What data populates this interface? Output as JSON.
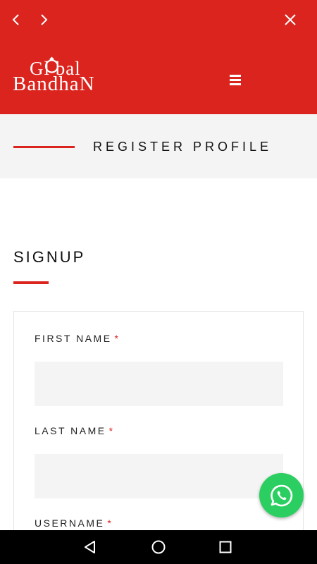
{
  "browser": {
    "back_icon": "chevron-left-icon",
    "forward_icon": "chevron-right-icon",
    "close_icon": "close-icon"
  },
  "header": {
    "logo_top": "Gl bal",
    "logo_bottom": "BandhaN",
    "menu_icon": "hamburger-menu-icon",
    "background_color": "#db241e"
  },
  "page_title": "REGISTER PROFILE",
  "signup": {
    "heading": "SIGNUP"
  },
  "form": {
    "fields": [
      {
        "label": "FIRST NAME",
        "required_mark": "*",
        "value": ""
      },
      {
        "label": "LAST NAME",
        "required_mark": "*",
        "value": ""
      },
      {
        "label": "USERNAME",
        "required_mark": "*"
      }
    ]
  },
  "whatsapp": {
    "icon": "whatsapp-icon",
    "color": "#2bcf61"
  },
  "system_nav": {
    "back_icon": "triangle-back-icon",
    "home_icon": "circle-home-icon",
    "recents_icon": "square-recents-icon"
  },
  "colors": {
    "accent": "#db241e",
    "field_bg": "#f4f4f4"
  }
}
